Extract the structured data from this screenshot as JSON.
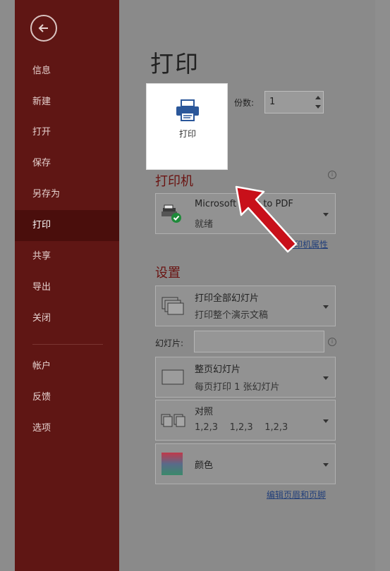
{
  "sidebar": {
    "items": [
      {
        "label": "信息"
      },
      {
        "label": "新建"
      },
      {
        "label": "打开"
      },
      {
        "label": "保存"
      },
      {
        "label": "另存为"
      },
      {
        "label": "打印"
      },
      {
        "label": "共享"
      },
      {
        "label": "导出"
      },
      {
        "label": "关闭"
      },
      {
        "label": "帐户"
      },
      {
        "label": "反馈"
      },
      {
        "label": "选项"
      }
    ]
  },
  "main": {
    "title": "打印",
    "print_button_label": "打印",
    "copies_label": "份数:",
    "copies_value": "1",
    "printer_section": "打印机",
    "printer_name": "Microsoft Print to PDF",
    "printer_status": "就绪",
    "printer_properties_link": "打印机属性",
    "settings_section": "设置",
    "range": {
      "title": "打印全部幻灯片",
      "subtitle": "打印整个演示文稿"
    },
    "slides_label": "幻灯片:",
    "slides_value": "",
    "layout": {
      "title": "整页幻灯片",
      "subtitle": "每页打印 1 张幻灯片"
    },
    "collate": {
      "title": "对照",
      "subtitle": "1,2,3    1,2,3    1,2,3"
    },
    "color": {
      "title": "颜色"
    },
    "header_footer_link": "编辑页眉和页脚"
  },
  "colors": {
    "sidebar_bg": "#5f1614",
    "accent": "#6a1311",
    "arrow": "#c8101a"
  }
}
